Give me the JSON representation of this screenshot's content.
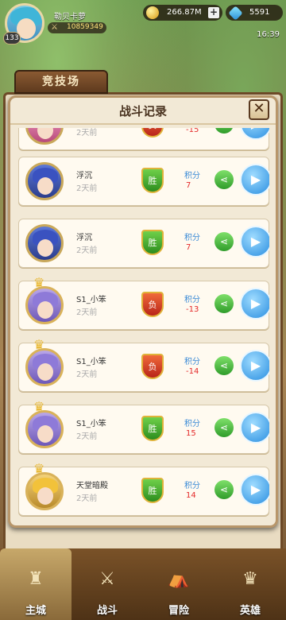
{
  "player": {
    "name": "勒贝卡萝",
    "level": "133",
    "power": "10859349"
  },
  "resources": {
    "gold": "266.87M",
    "gems": "5591"
  },
  "clock": "16:39",
  "arena_tab": "竞技场",
  "modal": {
    "title": "战斗记录",
    "close_symbol": "✕",
    "records": [
      {
        "name": "",
        "time": "2天前",
        "result": "负",
        "score_label": "积分",
        "score": "-15",
        "avatar": "pink"
      },
      {
        "name": "浮沉",
        "time": "2天前",
        "result": "胜",
        "score_label": "积分",
        "score": "7",
        "avatar": "blue"
      },
      {
        "name": "浮沉",
        "time": "2天前",
        "result": "胜",
        "score_label": "积分",
        "score": "7",
        "avatar": "blue"
      },
      {
        "name": "S1_小笨",
        "time": "2天前",
        "result": "负",
        "score_label": "积分",
        "score": "-13",
        "avatar": "purple"
      },
      {
        "name": "S1_小笨",
        "time": "2天前",
        "result": "负",
        "score_label": "积分",
        "score": "-14",
        "avatar": "purple"
      },
      {
        "name": "S1_小笨",
        "time": "2天前",
        "result": "胜",
        "score_label": "积分",
        "score": "15",
        "avatar": "purple"
      },
      {
        "name": "天堂暗殿",
        "time": "2天前",
        "result": "胜",
        "score_label": "积分",
        "score": "14",
        "avatar": "blond"
      }
    ]
  },
  "nav": [
    {
      "label": "主城",
      "icon": "castle-icon",
      "glyph": "♜",
      "active": true
    },
    {
      "label": "战斗",
      "icon": "swords-icon",
      "glyph": "⚔",
      "active": false
    },
    {
      "label": "冒险",
      "icon": "adventure-icon",
      "glyph": "⛺",
      "active": false
    },
    {
      "label": "英雄",
      "icon": "hero-icon",
      "glyph": "♛",
      "active": false
    }
  ]
}
